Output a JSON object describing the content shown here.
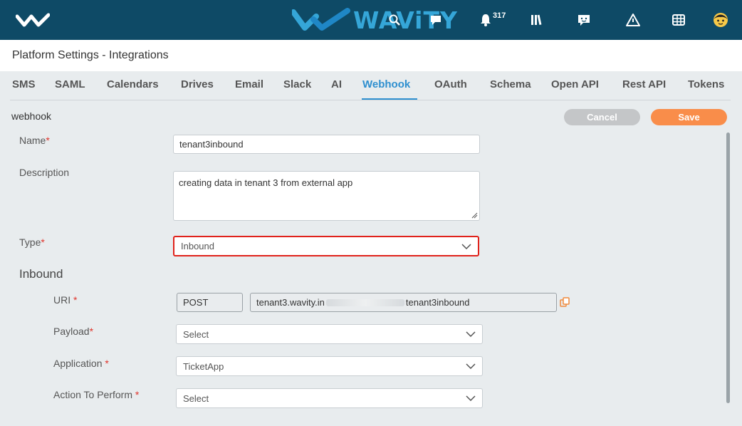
{
  "navbar": {
    "brand": "WAViTY",
    "notification_count": "317",
    "colors": {
      "bar": "#0e4a66",
      "brand": "#35a6d8"
    }
  },
  "header": {
    "title": "Platform Settings - Integrations"
  },
  "tabs": [
    {
      "label": "SMS"
    },
    {
      "label": "SAML"
    },
    {
      "label": "Calendars"
    },
    {
      "label": "Drives"
    },
    {
      "label": "Email"
    },
    {
      "label": "Slack"
    },
    {
      "label": "AI"
    },
    {
      "label": "Webhook"
    },
    {
      "label": "OAuth"
    },
    {
      "label": "Schema"
    },
    {
      "label": "Open API"
    },
    {
      "label": "Rest API"
    },
    {
      "label": "Tokens"
    }
  ],
  "active_tab": "Webhook",
  "section": {
    "label": "webhook",
    "cancel_label": "Cancel",
    "save_label": "Save"
  },
  "form": {
    "name": {
      "label": "Name",
      "value": "tenant3inbound"
    },
    "description": {
      "label": "Description",
      "value": "creating data in tenant 3 from external app"
    },
    "type": {
      "label": "Type",
      "value": "Inbound"
    },
    "inbound_heading": "Inbound",
    "uri": {
      "label": "URI",
      "method": "POST",
      "value_start": "tenant3.wavity.in",
      "value_end": "tenant3inbound"
    },
    "payload": {
      "label": "Payload",
      "value": "Select"
    },
    "application": {
      "label": "Application",
      "value": "TicketApp"
    },
    "action": {
      "label": "Action To Perform",
      "value": "Select"
    }
  }
}
